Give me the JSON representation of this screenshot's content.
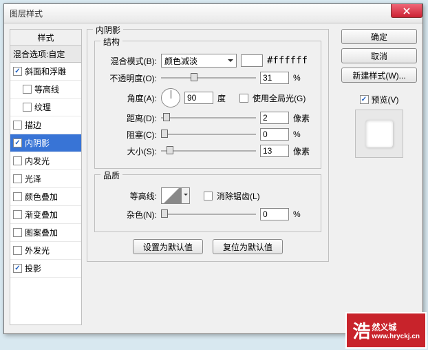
{
  "dialog": {
    "title": "图层样式"
  },
  "sidebar": {
    "header": "样式",
    "subheader": "混合选项:自定",
    "items": [
      {
        "label": "斜面和浮雕",
        "checked": true,
        "sub": false
      },
      {
        "label": "等高线",
        "checked": false,
        "sub": true
      },
      {
        "label": "纹理",
        "checked": false,
        "sub": true
      },
      {
        "label": "描边",
        "checked": false,
        "sub": false
      },
      {
        "label": "内阴影",
        "checked": true,
        "sub": false,
        "selected": true
      },
      {
        "label": "内发光",
        "checked": false,
        "sub": false
      },
      {
        "label": "光泽",
        "checked": false,
        "sub": false
      },
      {
        "label": "颜色叠加",
        "checked": false,
        "sub": false
      },
      {
        "label": "渐变叠加",
        "checked": false,
        "sub": false
      },
      {
        "label": "图案叠加",
        "checked": false,
        "sub": false
      },
      {
        "label": "外发光",
        "checked": false,
        "sub": false
      },
      {
        "label": "投影",
        "checked": true,
        "sub": false
      }
    ]
  },
  "panel": {
    "title": "内阴影",
    "structure": {
      "legend": "结构",
      "blend_label": "混合模式(B):",
      "blend_value": "颜色减淡",
      "hex": "#ffffff",
      "opacity_label": "不透明度(O):",
      "opacity_value": "31",
      "opacity_unit": "%",
      "angle_label": "角度(A):",
      "angle_value": "90",
      "angle_unit": "度",
      "global_label": "使用全局光(G)",
      "distance_label": "距离(D):",
      "distance_value": "2",
      "distance_unit": "像素",
      "choke_label": "阻塞(C):",
      "choke_value": "0",
      "choke_unit": "%",
      "size_label": "大小(S):",
      "size_value": "13",
      "size_unit": "像素"
    },
    "quality": {
      "legend": "品质",
      "contour_label": "等高线:",
      "antialias_label": "消除锯齿(L)",
      "noise_label": "杂色(N):",
      "noise_value": "0",
      "noise_unit": "%"
    },
    "buttons": {
      "default": "设置为默认值",
      "reset": "复位为默认值"
    }
  },
  "right": {
    "ok": "确定",
    "cancel": "取消",
    "newstyle": "新建样式(W)...",
    "preview_label": "预览(V)"
  },
  "watermark": {
    "brand1": "浩",
    "brand2": "然义城",
    "url": "www.hryckj.cn"
  }
}
